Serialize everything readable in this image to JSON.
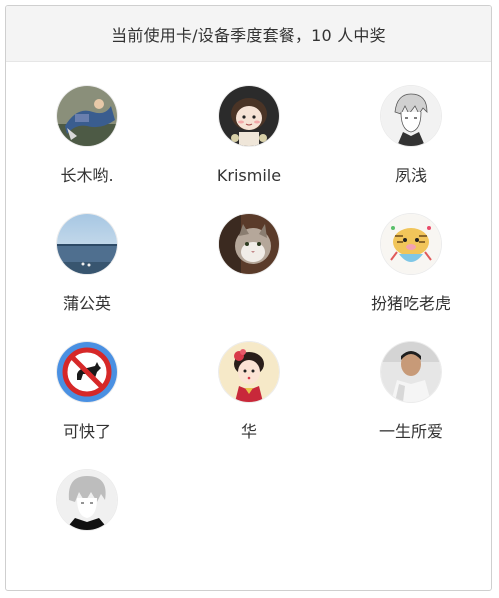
{
  "header": {
    "title": "当前使用卡/设备季度套餐，10 人中奖"
  },
  "winners": [
    {
      "name": "长木哟.",
      "avatar": "man-on-rocks-avatar"
    },
    {
      "name": "Krismile",
      "avatar": "cartoon-girl-avatar"
    },
    {
      "name": "夙浅",
      "avatar": "manga-boy-avatar"
    },
    {
      "name": "蒲公英",
      "avatar": "seaside-avatar"
    },
    {
      "name": "",
      "avatar": "cat-avatar"
    },
    {
      "name": "扮猪吃老虎",
      "avatar": "pig-tiger-avatar"
    },
    {
      "name": "可快了",
      "avatar": "no-dogs-sign-avatar"
    },
    {
      "name": "华",
      "avatar": "chinese-doll-avatar"
    },
    {
      "name": "一生所爱",
      "avatar": "man-selfie-avatar"
    },
    {
      "name": "",
      "avatar": "anime-boy-avatar"
    }
  ]
}
